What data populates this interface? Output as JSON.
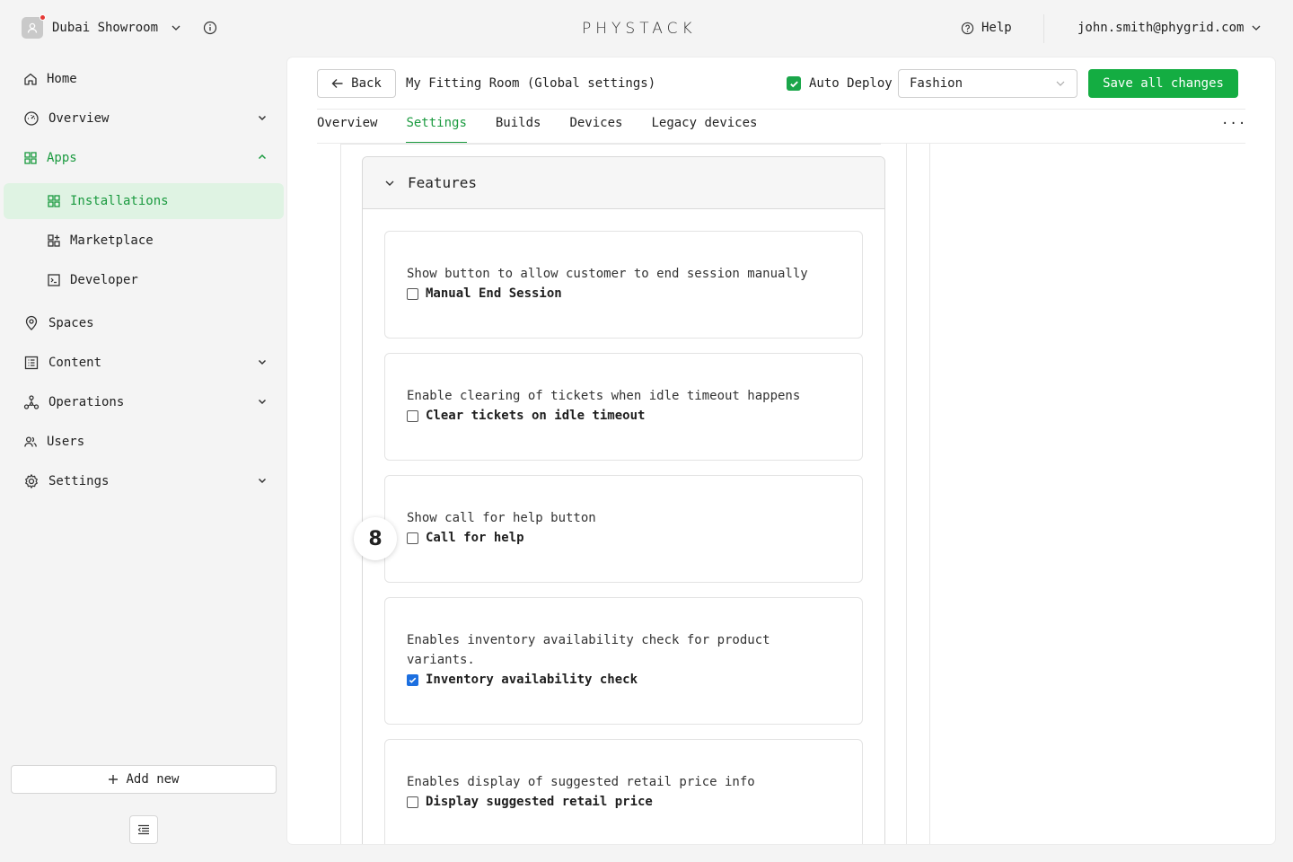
{
  "org": {
    "name": "Dubai Showroom"
  },
  "brand": {
    "logo_text": "PHYSTACK"
  },
  "header": {
    "help_label": "Help",
    "user_email": "john.smith@phygrid.com"
  },
  "sidebar": {
    "items": [
      {
        "label": "Home",
        "icon": "home-icon"
      },
      {
        "label": "Overview",
        "icon": "dashboard-icon",
        "chevron": "down"
      },
      {
        "label": "Apps",
        "icon": "apps-grid-icon",
        "chevron": "up",
        "expanded": true
      },
      {
        "label": "Installations",
        "icon": "apps-grid-icon",
        "active": true
      },
      {
        "label": "Marketplace",
        "icon": "marketplace-icon"
      },
      {
        "label": "Developer",
        "icon": "terminal-icon"
      },
      {
        "label": "Spaces",
        "icon": "location-pin-icon"
      },
      {
        "label": "Content",
        "icon": "content-list-icon",
        "chevron": "down"
      },
      {
        "label": "Operations",
        "icon": "network-icon",
        "chevron": "down"
      },
      {
        "label": "Users",
        "icon": "users-icon"
      },
      {
        "label": "Settings",
        "icon": "gear-icon",
        "chevron": "down"
      }
    ],
    "add_new_label": "Add new"
  },
  "toolbar": {
    "back_label": "Back",
    "page_title": "My Fitting Room (Global settings)",
    "auto_deploy_label": "Auto Deploy",
    "auto_deploy_checked": true,
    "env_select_value": "Fashion",
    "save_label": "Save all changes"
  },
  "tabs": [
    {
      "label": "Overview"
    },
    {
      "label": "Settings",
      "active": true
    },
    {
      "label": "Builds"
    },
    {
      "label": "Devices"
    },
    {
      "label": "Legacy devices"
    }
  ],
  "more_label": "...",
  "features": {
    "title": "Features",
    "cards": [
      {
        "description": "Show button to allow customer to end session manually",
        "option": "Manual End Session",
        "checked": false
      },
      {
        "description": "Enable clearing of tickets when idle timeout happens",
        "option": "Clear tickets on idle timeout",
        "checked": false
      },
      {
        "description": "Show call for help button",
        "option": "Call for help",
        "checked": false
      },
      {
        "description": "Enables inventory availability check for product variants.",
        "option": "Inventory availability check",
        "checked": true
      },
      {
        "description": "Enables display of suggested retail price info",
        "option": "Display suggested retail price",
        "checked": false
      }
    ]
  },
  "step_badge": "8",
  "colors": {
    "accent": "#1a9a3f",
    "save_button": "#14ad42",
    "active_bg": "#dff3e3",
    "checkbox_checked": "#1c6fe0"
  }
}
